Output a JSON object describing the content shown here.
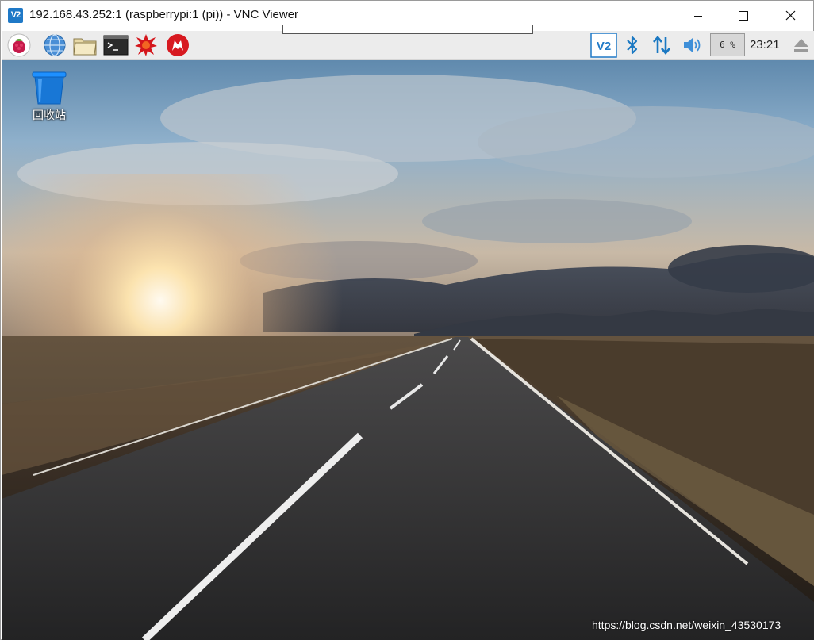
{
  "window": {
    "title": "192.168.43.252:1 (raspberrypi:1 (pi)) - VNC Viewer",
    "app_icon_text": "V2",
    "controls": [
      "minimize-icon",
      "maximize-icon",
      "close-icon"
    ]
  },
  "taskbar": {
    "launchers": [
      "raspberry-menu-icon",
      "web-browser-icon",
      "file-manager-icon",
      "terminal-icon",
      "wolfram-icon",
      "mathematica-icon"
    ],
    "tray": {
      "vnc_icon_text": "V2",
      "cpu_usage": "6 %",
      "cpu_value": 6,
      "clock": "23:21"
    }
  },
  "desktop": {
    "icons": [
      {
        "label": "回收站",
        "icon": "trash-icon"
      }
    ],
    "watermark": "https://blog.csdn.net/weixin_43530173"
  },
  "colors": {
    "accent": "#1f79c7",
    "taskbar_bg": "#ececec",
    "sky_top": "#5b87ad",
    "sunset": "#ffe3a8",
    "road": "#2a2a2a"
  }
}
